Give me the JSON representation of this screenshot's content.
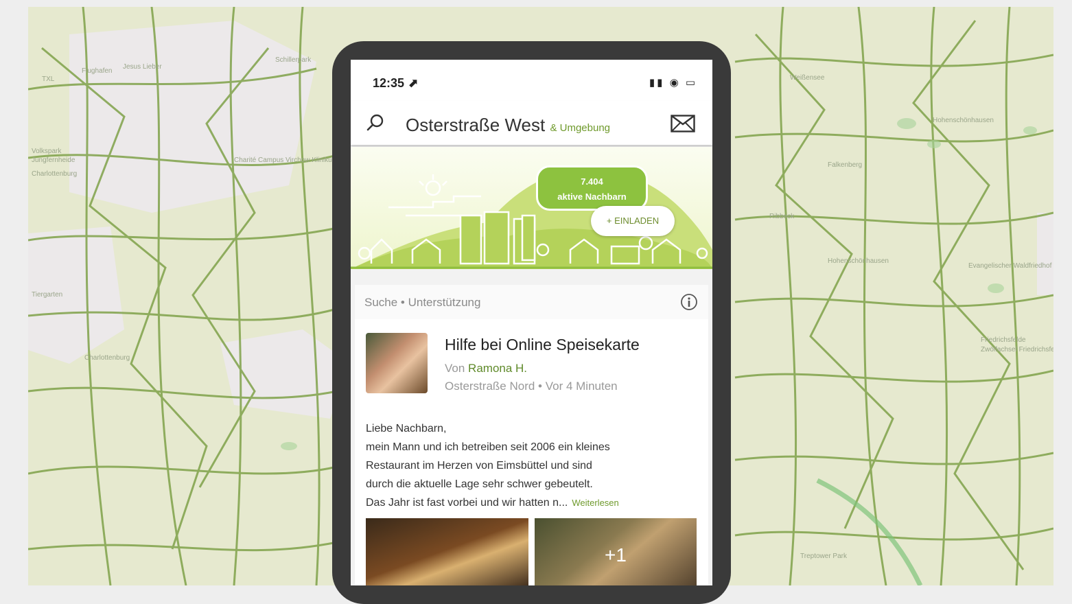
{
  "map": {
    "labels": [
      "TXL",
      "Flughafen",
      "Jesus Lieber",
      "Schillerpark",
      "Volkspark",
      "Jungfernheide",
      "Charlottenburg",
      "Charité Campus Virchow Klinikum",
      "Tiergarten",
      "Charlottenburg",
      "Hohenschönhausen",
      "Weißensee",
      "Falkenberg",
      "Ribbeck",
      "Hohenschönhausen",
      "Friedrichsfelde",
      "Evangelischer Waldfriedhof",
      "Zwölfachsel Friedrichsfelde",
      "Treptower Park"
    ]
  },
  "status_bar": {
    "time": "12:35 ⬈",
    "icons": "▮▮ ◉ ▭"
  },
  "app_bar": {
    "search_icon": "search-icon",
    "title": "Osterstraße West",
    "subtitle": "& Umgebung",
    "mail_icon": "mail-icon"
  },
  "banner": {
    "count": "7.404",
    "count_label": "aktive Nachbarn",
    "invite_label": "+ EINLADEN"
  },
  "search": {
    "label": "Suche • Unterstützung",
    "info_icon": "info-icon"
  },
  "post": {
    "title": "Hilfe bei Online Speisekarte",
    "author_prefix": "Von",
    "author": "Ramona H.",
    "meta": "Osterstraße Nord • Vor 4 Minuten",
    "body": [
      "Liebe Nachbarn,",
      "mein Mann und ich betreiben seit 2006 ein kleines",
      "Restaurant im Herzen von Eimsbüttel und sind",
      "durch die aktuelle Lage sehr schwer gebeutelt.",
      "Das Jahr ist fast vorbei und wir hatten n..."
    ],
    "read_more": "Weiterlesen",
    "more_photos": "+1"
  }
}
